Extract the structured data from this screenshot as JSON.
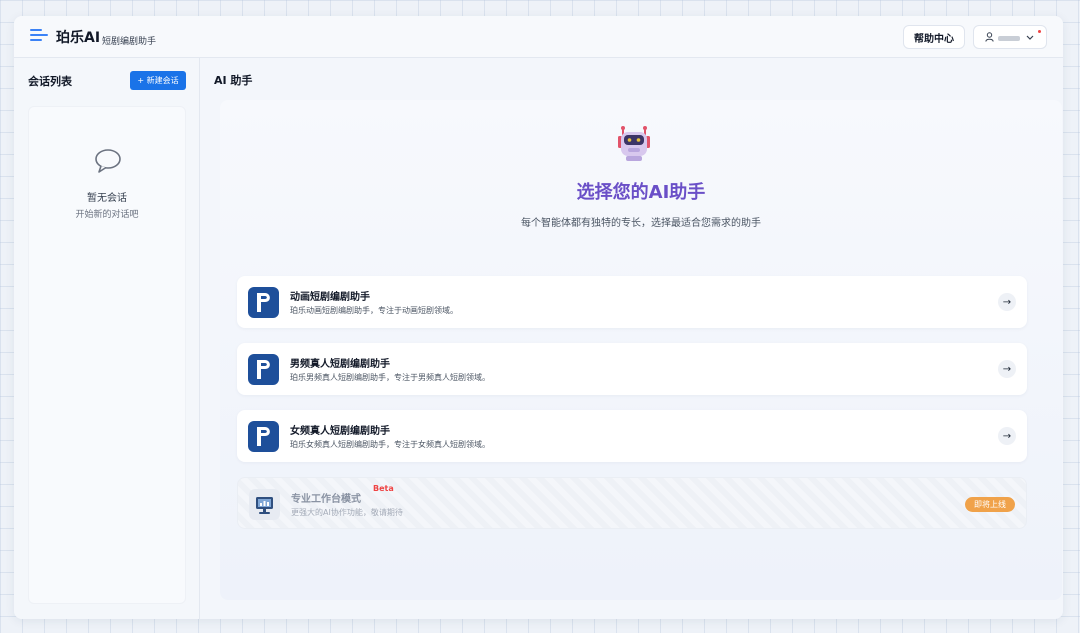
{
  "header": {
    "brand": "珀乐AI",
    "brand_sub": "短剧编剧助手",
    "help_label": "帮助中心",
    "user_icon": "user-icon",
    "user_chevron": "chevron-down-icon"
  },
  "sidebar": {
    "title": "会话列表",
    "new_button": "+ 新建会话",
    "empty_title": "暂无会话",
    "empty_sub": "开始新的对话吧"
  },
  "main": {
    "title": "AI 助手",
    "hero_title": "选择您的AI助手",
    "hero_sub": "每个智能体都有独特的专长，选择最适合您需求的助手",
    "assistants": [
      {
        "title": "动画短剧编剧助手",
        "desc": "珀乐动画短剧编剧助手，专注于动画短剧领域。",
        "icon": "p-logo-icon"
      },
      {
        "title": "男频真人短剧编剧助手",
        "desc": "珀乐男频真人短剧编剧助手，专注于男频真人短剧领域。",
        "icon": "p-logo-icon"
      },
      {
        "title": "女频真人短剧编剧助手",
        "desc": "珀乐女频真人短剧编剧助手，专注于女频真人短剧领域。",
        "icon": "p-logo-icon"
      }
    ],
    "pro": {
      "title": "专业工作台模式",
      "badge": "Beta",
      "desc": "更强大的AI协作功能，敬请期待",
      "status": "即将上线",
      "icon": "monitor-icon"
    }
  },
  "colors": {
    "accent": "#1a73e8",
    "hero_title": "#6a4fc7",
    "logo_bg": "#1e4f9a",
    "soon_badge": "#f0a24a",
    "beta": "#ef4444"
  }
}
